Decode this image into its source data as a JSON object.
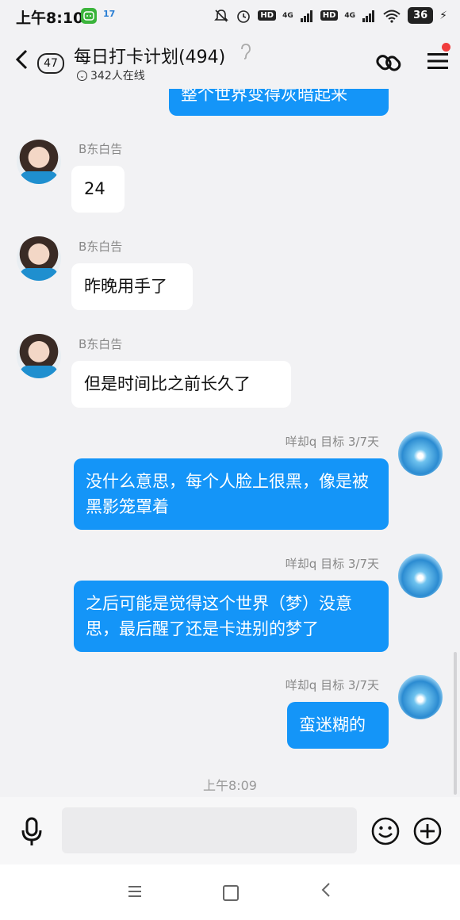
{
  "status_bar": {
    "time": "上午8:10",
    "app_icon_1_color": "#3bb43b",
    "app_icon_2_label": "17",
    "network_1": "HD",
    "network_1_type": "4G",
    "network_2": "HD",
    "network_2_type": "4G",
    "battery": "36"
  },
  "header": {
    "back_count": "47",
    "title": "每日打卡计划(494)",
    "online_text": "342人在线"
  },
  "messages": [
    {
      "type": "out",
      "text": "整个世界变得灰暗起来"
    },
    {
      "type": "in",
      "sender": "B东白告",
      "text": "24"
    },
    {
      "type": "in",
      "sender": "B东白告",
      "text": "昨晚用手了"
    },
    {
      "type": "in",
      "sender": "B东白告",
      "text": "但是时间比之前长久了"
    },
    {
      "type": "out",
      "sender": "咩却q 目标 3/7天",
      "text": "没什么意思，每个人脸上很黑，像是被黑影笼罩着"
    },
    {
      "type": "out",
      "sender": "咩却q 目标 3/7天",
      "text": "之后可能是觉得这个世界（梦）没意思，最后醒了还是卡进别的梦了"
    },
    {
      "type": "out",
      "sender": "咩却q 目标 3/7天",
      "text": "蛮迷糊的"
    }
  ],
  "timestamp": "上午8:09",
  "input": {
    "value": "",
    "placeholder": ""
  },
  "colors": {
    "bubble_out": "#1495f8",
    "bubble_in": "#ffffff",
    "background": "#f2f2f4",
    "badge_dot": "#f03c3c"
  }
}
